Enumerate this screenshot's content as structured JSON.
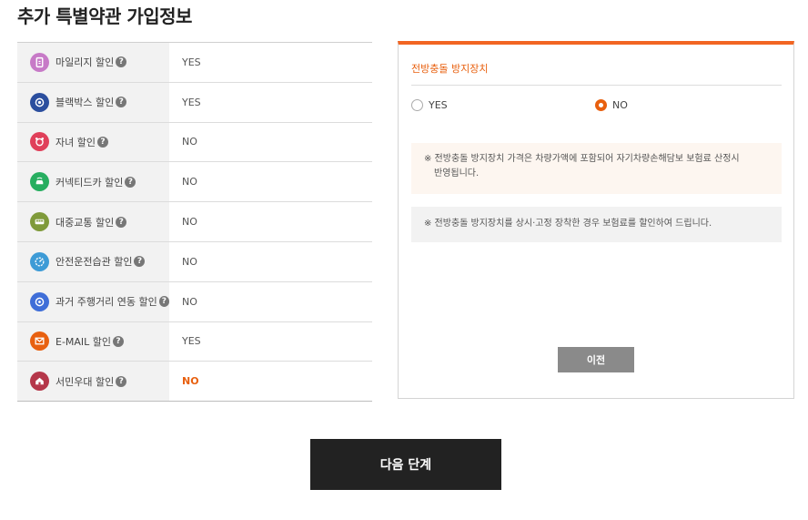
{
  "page": {
    "title": "추가 특별약관 가입정보"
  },
  "discounts": [
    {
      "icon": "mileage-icon",
      "color": "#c77ac7",
      "label": "마일리지 할인",
      "value": "YES",
      "highlight": false
    },
    {
      "icon": "blackbox-icon",
      "color": "#2b4e9e",
      "label": "블랙박스 할인",
      "value": "YES",
      "highlight": false
    },
    {
      "icon": "child-icon",
      "color": "#e0405a",
      "label": "자녀 할인",
      "value": "NO",
      "highlight": false
    },
    {
      "icon": "connected-car-icon",
      "color": "#27ae60",
      "label": "커넥티드카 할인",
      "value": "NO",
      "highlight": false
    },
    {
      "icon": "bus-icon",
      "color": "#7f9a3a",
      "label": "대중교통 할인",
      "value": "NO",
      "highlight": false
    },
    {
      "icon": "safe-driving-icon",
      "color": "#3d9bd6",
      "label": "안전운전습관 할인",
      "value": "NO",
      "highlight": false
    },
    {
      "icon": "odometer-icon",
      "color": "#3f6ed8",
      "label": "과거 주행거리 연동 할인",
      "value": "NO",
      "highlight": false
    },
    {
      "icon": "email-icon",
      "color": "#e8600f",
      "label": "E-MAIL 할인",
      "value": "YES",
      "highlight": false
    },
    {
      "icon": "house-icon",
      "color": "#b5374a",
      "label": "서민우대 할인",
      "value": "NO",
      "highlight": true
    }
  ],
  "panel": {
    "title": "전방충돌 방지장치",
    "options": [
      {
        "label": "YES",
        "checked": false
      },
      {
        "label": "NO",
        "checked": true
      }
    ],
    "notice1_line1": "※ 전방충돌 방지장치 가격은 차량가액에 포함되어 자기차량손해담보 보험료 산정시",
    "notice1_line2": "반영됩니다.",
    "notice2": "※ 전방충돌 방지장치를 상시·고정 장착한 경우 보험료를 할인하여 드립니다.",
    "prev_label": "이전"
  },
  "next_label": "다음 단계",
  "help_glyph": "?"
}
